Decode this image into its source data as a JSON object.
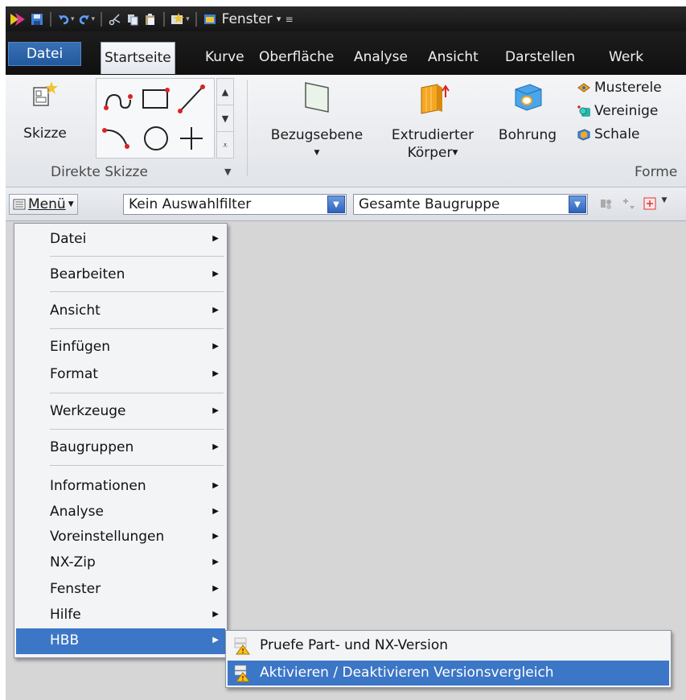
{
  "window": {
    "title": "Fenster",
    "title_arrow": "▾",
    "qa_menu": "≡"
  },
  "tabs": [
    {
      "label": "Datei"
    },
    {
      "label": "Startseite"
    },
    {
      "label": "Kurve"
    },
    {
      "label": "Oberfläche"
    },
    {
      "label": "Analyse"
    },
    {
      "label": "Ansicht"
    },
    {
      "label": "Darstellen"
    },
    {
      "label": "Werk"
    }
  ],
  "ribbon": {
    "sketch": {
      "label": "Skizze"
    },
    "direct_sketch_group": "Direkte Skizze",
    "datum_plane": {
      "label": "Bezugsebene"
    },
    "extrude": {
      "line1": "Extrudierter",
      "line2": "Körper"
    },
    "hole": {
      "label": "Bohrung"
    },
    "small_items": [
      "Musterele",
      "Vereinige",
      "Schale"
    ],
    "forms_group": "Forme"
  },
  "toolbar": {
    "menu_label": "Menü",
    "filter_value": "Kein Auswahlfilter",
    "scope_value": "Gesamte Baugruppe"
  },
  "menu": {
    "items": [
      {
        "label": "Datei"
      },
      {
        "label": "Bearbeiten"
      },
      {
        "label": "Ansicht"
      },
      {
        "label": "Einfügen"
      },
      {
        "label": "Format"
      },
      {
        "label": "Werkzeuge"
      },
      {
        "label": "Baugruppen"
      },
      {
        "label": "Informationen"
      },
      {
        "label": "Analyse"
      },
      {
        "label": "Voreinstellungen"
      },
      {
        "label": "NX-Zip"
      },
      {
        "label": "Fenster"
      },
      {
        "label": "Hilfe"
      },
      {
        "label": "HBB"
      }
    ],
    "submenu_arrow": "▶"
  },
  "submenu": {
    "items": [
      {
        "label": "Pruefe Part- und NX-Version"
      },
      {
        "label": "Aktivieren / Deaktivieren Versionsvergleich"
      }
    ]
  },
  "colors": {
    "highlight": "#3c76c6",
    "ribbon_dark": "#151515",
    "file_tab": "#2c63a8"
  }
}
